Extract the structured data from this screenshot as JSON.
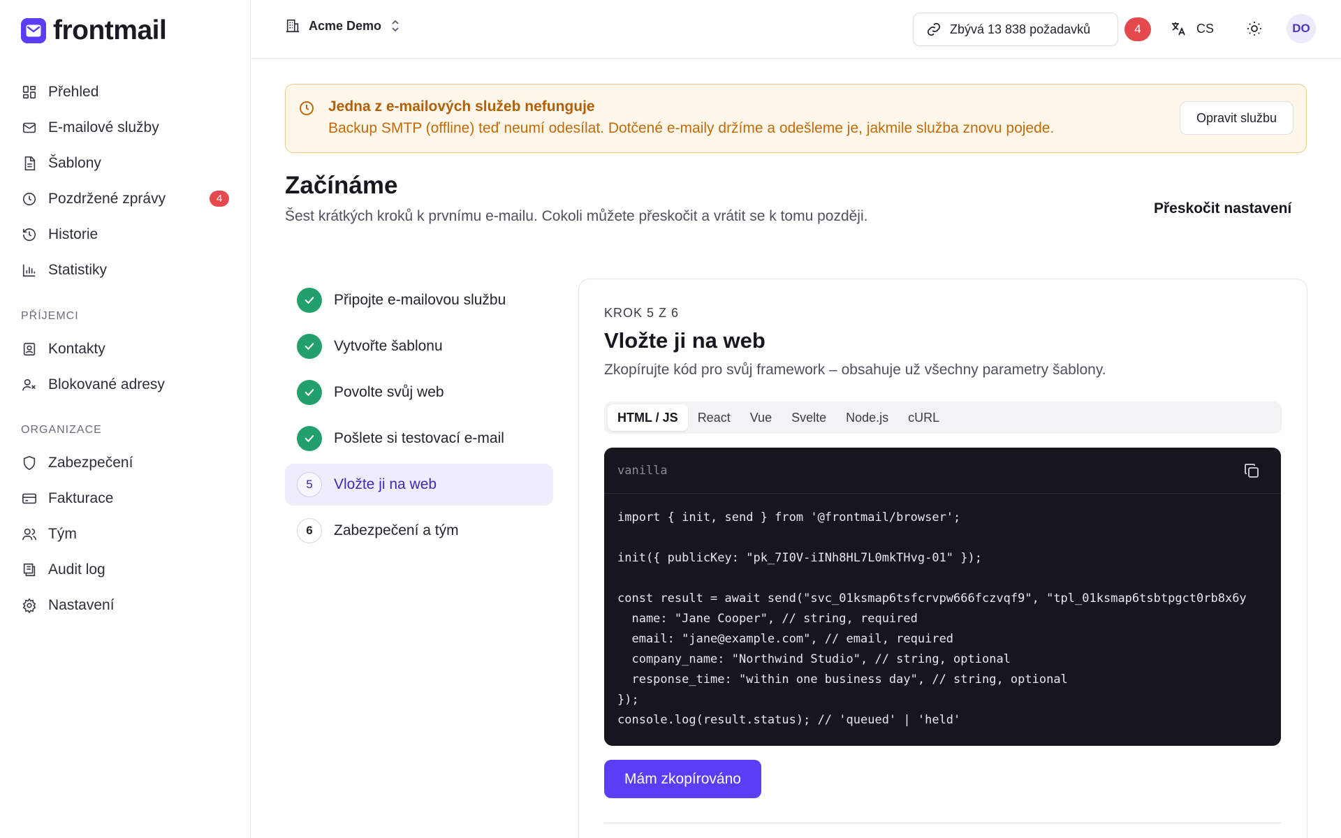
{
  "app": {
    "name": "frontmail"
  },
  "sidebar": {
    "items": [
      {
        "label": "Přehled",
        "icon": "dashboard-icon"
      },
      {
        "label": "E-mailové služby",
        "icon": "mail-icon"
      },
      {
        "label": "Šablony",
        "icon": "document-icon"
      },
      {
        "label": "Pozdržené zprávy",
        "icon": "clock-icon",
        "badge": "4"
      },
      {
        "label": "Historie",
        "icon": "history-icon"
      },
      {
        "label": "Statistiky",
        "icon": "bar-chart-icon"
      }
    ],
    "sections": [
      {
        "title": "PŘÍJEMCI",
        "items": [
          {
            "label": "Kontakty",
            "icon": "contact-icon"
          },
          {
            "label": "Blokované adresy",
            "icon": "user-blocked-icon"
          }
        ]
      },
      {
        "title": "ORGANIZACE",
        "items": [
          {
            "label": "Zabezpečení",
            "icon": "shield-icon"
          },
          {
            "label": "Fakturace",
            "icon": "credit-card-icon"
          },
          {
            "label": "Tým",
            "icon": "users-icon"
          },
          {
            "label": "Audit log",
            "icon": "audit-log-icon"
          },
          {
            "label": "Nastavení",
            "icon": "gear-icon"
          }
        ]
      }
    ]
  },
  "topbar": {
    "org_name": "Acme Demo",
    "quota": "Zbývá 13 838 požadavků",
    "notifications": "4",
    "language": "CS",
    "avatar": "DO"
  },
  "alert": {
    "title": "Jedna z e-mailových služeb nefunguje",
    "text": "Backup SMTP (offline) teď neumí odesílat. Dotčené e-maily držíme a odešleme je, jakmile služba znovu pojede.",
    "button": "Opravit službu",
    "color": "#c46a0a"
  },
  "page": {
    "title": "Začínáme",
    "subtitle": "Šest krátkých kroků k prvnímu e-mailu. Cokoli můžete přeskočit a vrátit se k tomu později.",
    "skip": "Přeskočit nastavení"
  },
  "steps": [
    {
      "num": "1",
      "label": "Připojte e-mailovou službu",
      "done": true
    },
    {
      "num": "2",
      "label": "Vytvořte šablonu",
      "done": true
    },
    {
      "num": "3",
      "label": "Povolte svůj web",
      "done": true
    },
    {
      "num": "4",
      "label": "Pošlete si testovací e-mail",
      "done": true
    },
    {
      "num": "5",
      "label": "Vložte ji na web",
      "done": false,
      "active": true
    },
    {
      "num": "6",
      "label": "Zabezpečení a tým",
      "done": false
    }
  ],
  "card": {
    "step_label": "KROK 5 Z 6",
    "title": "Vložte ji na web",
    "subtitle": "Zkopírujte kód pro svůj framework – obsahuje už všechny parametry šablony.",
    "tabs": [
      "HTML / JS",
      "React",
      "Vue",
      "Svelte",
      "Node.js",
      "cURL"
    ],
    "active_tab": "HTML / JS",
    "code_variant": "vanilla",
    "code": "import { init, send } from '@frontmail/browser';\n\ninit({ publicKey: \"pk_7I0V-iINh8HL7L0mkTHvg-01\" });\n\nconst result = await send(\"svc_01ksmap6tsfcrvpw666fczvqf9\", \"tpl_01ksmap6tsbtpgct0rb8x6y\n  name: \"Jane Cooper\", // string, required\n  email: \"jane@example.com\", // email, required\n  company_name: \"Northwind Studio\", // string, optional\n  response_time: \"within one business day\", // string, optional\n});\nconsole.log(result.status); // 'queued' | 'held'",
    "primary_button": "Mám zkopírováno",
    "accent_color": "#5b3df5"
  }
}
